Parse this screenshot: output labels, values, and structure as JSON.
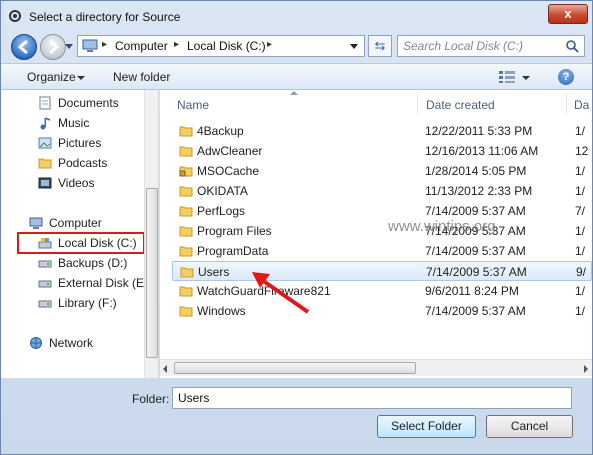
{
  "window": {
    "title": "Select a directory for Source",
    "close_label": "x"
  },
  "address": {
    "crumbs": [
      "Computer",
      "Local Disk (C:)"
    ]
  },
  "search": {
    "placeholder": "Search Local Disk (C:)"
  },
  "toolbar": {
    "organize_label": "Organize",
    "new_folder_label": "New folder",
    "help_label": "?"
  },
  "nav": {
    "favorites": [
      {
        "label": "Documents",
        "icon": "documents-icon"
      },
      {
        "label": "Music",
        "icon": "music-icon"
      },
      {
        "label": "Pictures",
        "icon": "pictures-icon"
      },
      {
        "label": "Podcasts",
        "icon": "folder-icon"
      },
      {
        "label": "Videos",
        "icon": "videos-icon"
      }
    ],
    "computer_label": "Computer",
    "drives": [
      {
        "label": "Local Disk (C:)",
        "selected": true
      },
      {
        "label": "Backups (D:)"
      },
      {
        "label": "External Disk (E:)"
      },
      {
        "label": "Library (F:)"
      }
    ],
    "network_label": "Network"
  },
  "columns": {
    "name": "Name",
    "date": "Date created",
    "third": "Da"
  },
  "files": [
    {
      "name": "4Backup",
      "date": "12/22/2011 5:33 PM",
      "d": "1/"
    },
    {
      "name": "AdwCleaner",
      "date": "12/16/2013 11:06 AM",
      "d": "12"
    },
    {
      "name": "MSOCache",
      "date": "1/28/2014 5:05 PM",
      "d": "1/"
    },
    {
      "name": "OKIDATA",
      "date": "11/13/2012 2:33 PM",
      "d": "1/"
    },
    {
      "name": "PerfLogs",
      "date": "7/14/2009 5:37 AM",
      "d": "7/"
    },
    {
      "name": "Program Files",
      "date": "7/14/2009 5:37 AM",
      "d": "1/"
    },
    {
      "name": "ProgramData",
      "date": "7/14/2009 5:37 AM",
      "d": "1/"
    },
    {
      "name": "Users",
      "date": "7/14/2009 5:37 AM",
      "d": "9/",
      "selected": true
    },
    {
      "name": "WatchGuardFireware821",
      "date": "9/6/2011 8:24 PM",
      "d": "1/"
    },
    {
      "name": "Windows",
      "date": "7/14/2009 5:37 AM",
      "d": "1/"
    }
  ],
  "watermark": "www.wintips.org",
  "footer": {
    "folder_label": "Folder:",
    "folder_value": "Users",
    "select_label": "Select Folder",
    "cancel_label": "Cancel"
  },
  "colors": {
    "annotation_red": "#e01818",
    "accent_blue": "#3c7fb1"
  }
}
